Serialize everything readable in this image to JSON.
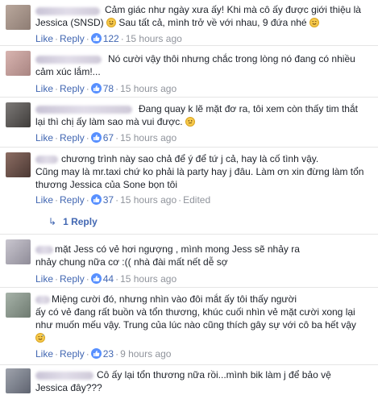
{
  "comments": [
    {
      "lines": [
        "Cảm giác như ngày xưa ấy! Khi mà cô ấy được giới thiệu là",
        "Jessica (SNSD)",
        " Sau tất cả, mình trở về với nhau, 9 đứa nhé"
      ],
      "like": "Like",
      "reply": "Reply",
      "likes": "122",
      "time": "15 hours ago",
      "edited": ""
    },
    {
      "lines": [
        "Nó cười vậy thôi nhưng chắc trong lòng nó đang có nhiều",
        "cảm xúc lắm!..."
      ],
      "like": "Like",
      "reply": "Reply",
      "likes": "78",
      "time": "15 hours ago",
      "edited": ""
    },
    {
      "lines": [
        "Đang quay k lẽ mặt đơ ra, tôi xem còn thấy tim thắt",
        "lại thì chị ấy làm sao mà vui được."
      ],
      "like": "Like",
      "reply": "Reply",
      "likes": "67",
      "time": "15 hours ago",
      "edited": ""
    },
    {
      "lines": [
        "chương trình này sao chả để ý để tứ j cả, hay là cố tình vậy.",
        "Cũng may là mr.taxi chứ ko phải là party hay j đâu. Làm ơn xin đừng làm tổn",
        "thương Jessica của Sone bọn tôi"
      ],
      "like": "Like",
      "reply": "Reply",
      "likes": "37",
      "time": "15 hours ago",
      "edited": "Edited"
    },
    {
      "lines": [
        "mặt Jess có vẻ hơi ngượng , mình mong Jess sẽ nhảy ra",
        "nhảy chung nữa cơ :(( nhà đài mất nết dễ sợ"
      ],
      "like": "Like",
      "reply": "Reply",
      "likes": "44",
      "time": "15 hours ago",
      "edited": ""
    },
    {
      "lines": [
        "Miệng cười đó, nhưng nhìn vào đôi mắt ấy tôi thấy người",
        "ấy có vẻ đang rất buồn và tổn thương, khúc cuối nhìn vẻ mặt cười xong lại",
        "như muốn mếu vậy. Trung của lúc nào cũng thích gây sự với cô ba hết vậy"
      ],
      "like": "Like",
      "reply": "Reply",
      "likes": "23",
      "time": "9 hours ago",
      "edited": ""
    },
    {
      "lines": [
        "Cô ấy lại tổn thương nữa rồi...mình bik làm j để bảo vệ",
        "Jessica đây???"
      ]
    }
  ],
  "replies_link": {
    "label": "1 Reply"
  },
  "colors": {
    "link": "#4267b2",
    "meta": "#90949c",
    "like_badge": "#5890ff"
  }
}
